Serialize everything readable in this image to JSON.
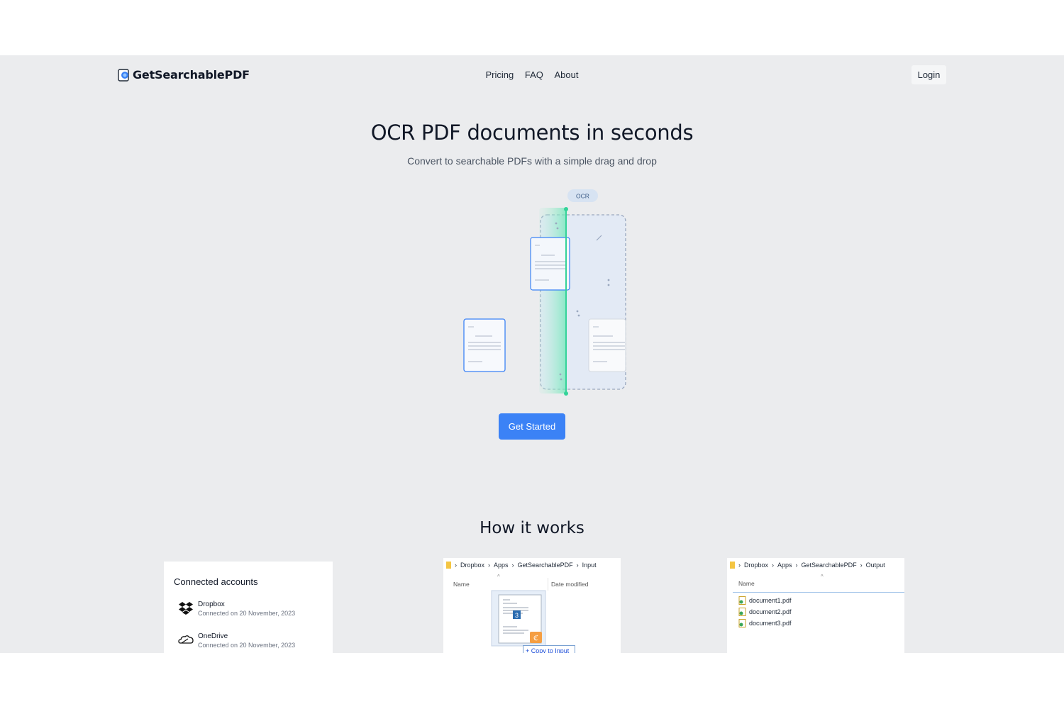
{
  "brand": {
    "name": "GetSearchablePDF"
  },
  "nav": {
    "items": [
      "Pricing",
      "FAQ",
      "About"
    ],
    "login": "Login"
  },
  "hero": {
    "title": "OCR PDF documents in seconds",
    "subtitle": "Convert to searchable PDFs with a simple drag and drop",
    "ocr_badge": "OCR",
    "cta": "Get Started"
  },
  "how": {
    "title": "How it works",
    "accounts": {
      "title": "Connected accounts",
      "items": [
        {
          "name": "Dropbox",
          "date": "Connected on 20 November, 2023",
          "icon": "dropbox-icon"
        },
        {
          "name": "OneDrive",
          "date": "Connected on 20 November, 2023",
          "icon": "onedrive-icon"
        }
      ]
    },
    "input_explorer": {
      "crumbs": [
        "Dropbox",
        "Apps",
        "GetSearchablePDF",
        "Input"
      ],
      "col_name": "Name",
      "col_date": "Date modified",
      "badge": "3",
      "tooltip": "+ Copy to Input"
    },
    "output_explorer": {
      "crumbs": [
        "Dropbox",
        "Apps",
        "GetSearchablePDF",
        "Output"
      ],
      "col_name": "Name",
      "files": [
        "document1.pdf",
        "document2.pdf",
        "document3.pdf"
      ]
    }
  },
  "colors": {
    "accent": "#3b82f6",
    "scan": "#34d399",
    "background": "#ebecee"
  }
}
